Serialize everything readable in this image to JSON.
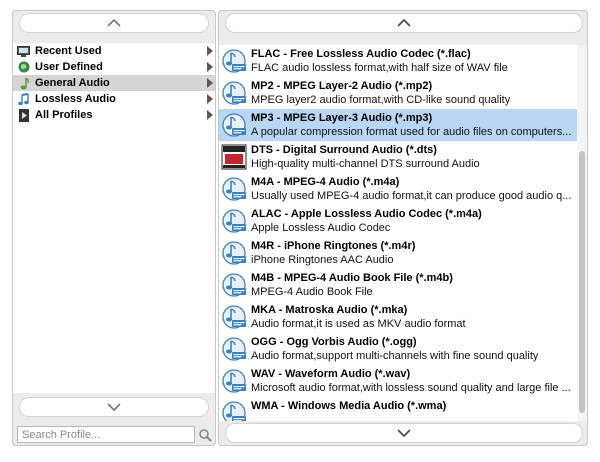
{
  "left": {
    "categories": [
      {
        "label": "Recent Used",
        "icon": "monitor-icon"
      },
      {
        "label": "User Defined",
        "icon": "globe-icon"
      },
      {
        "label": "General Audio",
        "icon": "music-note-icon",
        "selected": true
      },
      {
        "label": "Lossless Audio",
        "icon": "double-note-icon"
      },
      {
        "label": "All Profiles",
        "icon": "play-triangle-icon"
      }
    ],
    "search_placeholder": "Search Profile..."
  },
  "right": {
    "formats": [
      {
        "title": "FLAC - Free Lossless Audio Codec (*.flac)",
        "desc": "FLAC audio lossless format,with half size of WAV file",
        "icon": "flac-icon"
      },
      {
        "title": "MP2 - MPEG Layer-2 Audio (*.mp2)",
        "desc": "MPEG layer2 audio format,with CD-like sound quality",
        "icon": "mp2-icon"
      },
      {
        "title": "MP3 - MPEG Layer-3 Audio (*.mp3)",
        "desc": "A popular compression format used for audio files on computers...",
        "icon": "mp3-icon",
        "selected": true
      },
      {
        "title": "DTS - Digital Surround Audio (*.dts)",
        "desc": "High-quality multi-channel DTS surround Audio",
        "icon": "dts-logo-icon"
      },
      {
        "title": "M4A - MPEG-4 Audio (*.m4a)",
        "desc": "Usually used MPEG-4 audio format,it can produce good audio q...",
        "icon": "m4a-icon"
      },
      {
        "title": "ALAC - Apple Lossless Audio Codec (*.m4a)",
        "desc": "Apple Lossless Audio Codec",
        "icon": "alac-icon"
      },
      {
        "title": "M4R - iPhone Ringtones (*.m4r)",
        "desc": "iPhone Ringtones AAC Audio",
        "icon": "m4r-icon"
      },
      {
        "title": "M4B - MPEG-4 Audio Book File (*.m4b)",
        "desc": "MPEG-4 Audio Book File",
        "icon": "m4b-icon"
      },
      {
        "title": "MKA - Matroska Audio (*.mka)",
        "desc": "Audio format,it is used as MKV audio format",
        "icon": "mka-icon"
      },
      {
        "title": "OGG - Ogg Vorbis Audio (*.ogg)",
        "desc": "Audio format,support multi-channels with fine sound quality",
        "icon": "ogg-icon"
      },
      {
        "title": "WAV - Waveform Audio (*.wav)",
        "desc": "Microsoft audio format,with lossless sound quality and large file ...",
        "icon": "wav-icon"
      },
      {
        "title": "WMA - Windows Media Audio (*.wma)",
        "desc": "",
        "icon": "wma-icon"
      }
    ]
  },
  "colors": {
    "selection": "#b9d6f5",
    "category_selection": "#d5d5d5",
    "icon_blue": "#3b7fc4"
  }
}
